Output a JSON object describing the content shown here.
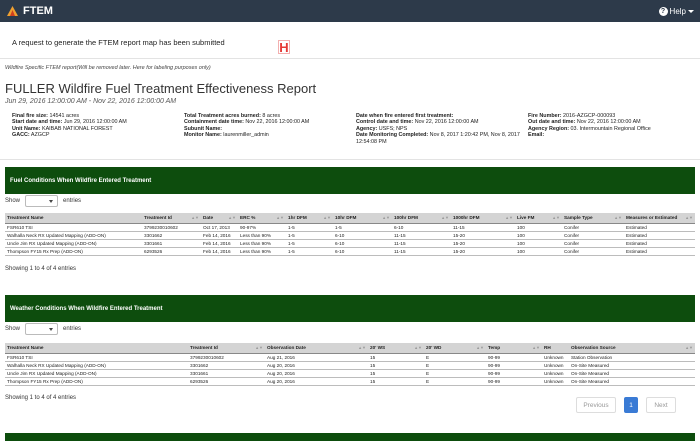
{
  "app": {
    "name": "FTEM",
    "help_label": "Help"
  },
  "notice": "A request to generate the FTEM report map has been submitted",
  "note": "Wildfire Specific FTEM report(Will be removed later. Here for labeling purposes only)",
  "report": {
    "title": "FULLER Wildfire Fuel Treatment Effectiveness Report",
    "dates": "Jun 29, 2016 12:00:00 AM - Nov 22, 2016 12:00:00 AM"
  },
  "meta": {
    "col1": [
      {
        "label": "Final fire size:",
        "value": "14541 acres"
      },
      {
        "label": "Start date and time:",
        "value": "Jun 29, 2016 12:00:00 AM"
      },
      {
        "label": "Unit Name:",
        "value": "KAIBAB NATIONAL FOREST"
      },
      {
        "label": "GACC:",
        "value": "AZGCP"
      }
    ],
    "col2": [
      {
        "label": "Total Treatment acres burned:",
        "value": "8 acres"
      },
      {
        "label": "Containment date time:",
        "value": "Nov 22, 2016 12:00:00 AM"
      },
      {
        "label": "Subunit Name:",
        "value": ""
      },
      {
        "label": "Monitor Name:",
        "value": "laurenmiller_admin"
      }
    ],
    "col3": [
      {
        "label": "Date when fire entered first treatment:",
        "value": ""
      },
      {
        "label": "Control date and time:",
        "value": "Nov 22, 2016 12:00:00 AM"
      },
      {
        "label": "Agency:",
        "value": "USFS; NPS"
      },
      {
        "label": "Date Monitoring Completed:",
        "value": "Nov 8, 2017 1:20:42 PM, Nov 8, 2017 12:54:08 PM"
      }
    ],
    "col4": [
      {
        "label": "Fire Number:",
        "value": "2016-AZGCP-000093"
      },
      {
        "label": "Out date and time:",
        "value": "Nov 22, 2016 12:00:00 AM"
      },
      {
        "label": "Agency Region:",
        "value": "03. Intermountain Regional Office"
      },
      {
        "label": "Email:",
        "value": ""
      }
    ]
  },
  "fuel": {
    "title": "Fuel Conditions When Wildfire Entered Treatment",
    "show_label": "Show",
    "entries_label": "entries",
    "headers": [
      "Treatment Name",
      "Treatment Id",
      "Date",
      "ERC %",
      "1hr DFM",
      "10hr DFM",
      "100hr DFM",
      "1000hr DFM",
      "Live FM",
      "Sample Type",
      "Measures or Estimated"
    ],
    "rows": [
      [
        "FSR610 TSI",
        "3799230010602",
        "Oct 17, 2013",
        "90-97%",
        "1-5",
        "1-5",
        "6-10",
        "11-15",
        "100",
        "Conifer",
        "Estimated"
      ],
      [
        "Walhalla Neck RX Updated Mapping (ADD-ON)",
        "3301662",
        "Feb 14, 2016",
        "Less than 90%",
        "1-5",
        "6-10",
        "11-15",
        "15-20",
        "100",
        "Conifer",
        "Estimated"
      ],
      [
        "Uncle Jim RX Updated Mapping (ADD-ON)",
        "3301661",
        "Feb 14, 2016",
        "Less than 90%",
        "1-5",
        "6-10",
        "11-15",
        "15-20",
        "100",
        "Conifer",
        "Estimated"
      ],
      [
        "Thompson FY15 Rx Prep (ADD-ON)",
        "6293526",
        "Feb 14, 2016",
        "Less than 90%",
        "1-5",
        "6-10",
        "11-15",
        "15-20",
        "100",
        "Conifer",
        "Estimated"
      ]
    ],
    "footer": "Showing 1 to 4 of 4 entries"
  },
  "weather": {
    "title": "Weather Conditions When Wildfire Entered Treatment",
    "show_label": "Show",
    "entries_label": "entries",
    "headers": [
      "Treatment Name",
      "Treatment Id",
      "Observation Date",
      "20' WS",
      "20' WD",
      "Temp",
      "RH",
      "Observation Source"
    ],
    "rows": [
      [
        "FSR610 TSI",
        "3799230010602",
        "Aug 21, 2016",
        "15",
        "E",
        "90-99",
        "Unknown",
        "Station Observation"
      ],
      [
        "Walhalla Neck RX Updated Mapping (ADD-ON)",
        "3301662",
        "Aug 20, 2016",
        "15",
        "E",
        "90-99",
        "Unknown",
        "On-Site Measured"
      ],
      [
        "Uncle Jim RX Updated Mapping (ADD-ON)",
        "3301661",
        "Aug 20, 2016",
        "15",
        "E",
        "90-99",
        "Unknown",
        "On-Site Measured"
      ],
      [
        "Thompson FY15 Rx Prep (ADD-ON)",
        "6293526",
        "Aug 20, 2016",
        "15",
        "E",
        "90-99",
        "Unknown",
        "On-Site Measured"
      ]
    ],
    "footer": "Showing 1 to 4 of 4 entries"
  },
  "pagination": {
    "previous": "Previous",
    "page": "1",
    "next": "Next"
  },
  "colors": {
    "topbar": "#2d3a4a",
    "section": "#0d4d0d",
    "accent": "#3a7bd5",
    "marker": "#e53935"
  }
}
